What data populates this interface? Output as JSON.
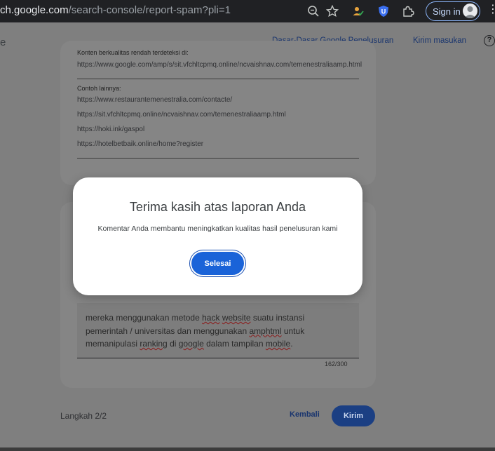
{
  "browser": {
    "url_host_prefix": "ch.google.com",
    "url_path": "/search-console/report-spam?pli=1",
    "signin_label": "Sign in"
  },
  "header": {
    "left_fragment": "e",
    "link_basics": "Dasar-Dasar Google Penelusuran",
    "link_feedback": "Kirim masukan"
  },
  "report": {
    "low_quality_label": "Konten berkualitas rendah terdeteksi di:",
    "low_quality_url": "https://www.google.com/amp/s/sit.vfchltcpmq.online/ncvaishnav.com/temenestraliaamp.html",
    "other_examples_label": "Contoh lainnya:",
    "other_urls": [
      "https://www.restaurantemenestralia.com/contacte/",
      "https://sit.vfchltcpmq.online/ncvaishnav.com/temenestraliaamp.html",
      "https://hoki.ink/gaspol",
      "https://hotelbetbaik.online/home?register"
    ]
  },
  "comment": {
    "line1_a": "mereka menggunakan metode ",
    "line1_b": "hack",
    "line1_c": " ",
    "line1_d": "website",
    "line1_e": " suatu instansi",
    "line2_a": "pemerintah / universitas dan menggunakan ",
    "line2_b": "amphtml",
    "line2_c": " untuk",
    "line3_a": "memanipulasi ",
    "line3_b": "ranking",
    "line3_c": " di ",
    "line3_d": "google",
    "line3_e": " dalam tampilan ",
    "line3_f": "mobile",
    "line3_g": ".",
    "counter": "162/300"
  },
  "footer": {
    "step": "Langkah 2/2",
    "back": "Kembali",
    "send": "Kirim"
  },
  "modal": {
    "title": "Terima kasih atas laporan Anda",
    "message": "Komentar Anda membantu meningkatkan kualitas hasil penelusuran kami",
    "done": "Selesai"
  },
  "colors": {
    "primary_button": "#1a63d8",
    "link": "#18346e",
    "browser_bar": "#202124"
  }
}
